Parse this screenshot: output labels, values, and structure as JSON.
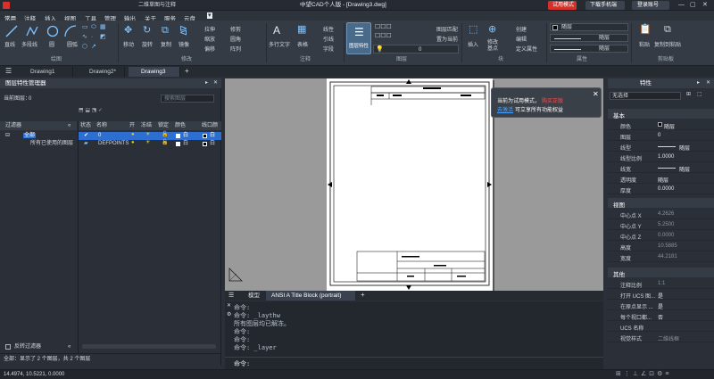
{
  "titlebar": {
    "app_title": "中望CAD个人版 - [Drawing3.dwg]",
    "workspace": "二维草图与注释",
    "trial_badge": "试用模式",
    "download_mobile": "下载手机端",
    "login": "登录账号"
  },
  "menu": {
    "items": [
      "常用",
      "注释",
      "插入",
      "视图",
      "工具",
      "管理",
      "输出",
      "关于",
      "服务",
      "云盘"
    ]
  },
  "ribbon": {
    "draw": [
      "直线",
      "多段线",
      "圆",
      "圆弧"
    ],
    "modify_big": [
      "移动",
      "旋转",
      "复制",
      "镜像"
    ],
    "modify_small": [
      "拉伸",
      "缩放",
      "偏移",
      "修剪",
      "圆角",
      "阵列"
    ],
    "annot": [
      "多行文字",
      "表格"
    ],
    "annot_small": [
      "线性",
      "引线",
      "字段"
    ],
    "layer_props": "图层特性",
    "layer_small": [
      "图层匹配",
      "置为当前"
    ],
    "layer_value": "0",
    "block": [
      "插入",
      "创建",
      "编辑",
      "定义属性"
    ],
    "block_base": "修改\n基点",
    "props": {
      "bylayer1": "随层",
      "bylayer2": "随层",
      "bylayer3": "随层"
    },
    "clip": [
      "粘贴",
      "复制到粘贴"
    ],
    "groups": [
      "绘图",
      "修改",
      "注释",
      "图层",
      "块",
      "属性",
      "剪贴板"
    ]
  },
  "tabs": {
    "items": [
      "Drawing1",
      "Drawing2*",
      "Drawing3"
    ]
  },
  "layer_manager": {
    "title": "图层特性管理器",
    "current_layer_label": "当前图层：",
    "current_layer": "0",
    "search_placeholder": "搜索图层",
    "filter_header": "过滤器",
    "filter_all": "全部",
    "filter_used": "所有已使用的图层",
    "columns": [
      "状态",
      "名称",
      "开",
      "冻结",
      "锁定",
      "颜色",
      "线口颜"
    ],
    "rows": [
      {
        "name": "0",
        "color": "白"
      },
      {
        "name": "DEFPOINTS",
        "color": "白"
      }
    ],
    "invert_filter": "反转过滤器",
    "footer": "全部：显示了 2 个图层，共 2 个图层"
  },
  "toast": {
    "line1": "当前为试用模式，",
    "line1_red": "购买正版",
    "line2_link": "去激活",
    "line2_rest": "可立享所有功能权益"
  },
  "canvas_tabs": {
    "model": "模型",
    "layout": "ANSI A Title Block (portrait)"
  },
  "command": {
    "lines": [
      "命令:",
      "命令: _laythw",
      "所有图层均已解冻。",
      "命令:",
      "命令:",
      "命令: _layer"
    ],
    "prompt": "命令:"
  },
  "properties": {
    "title": "特性",
    "selection": "无选择",
    "sections": {
      "basic": "基本",
      "view": "视图",
      "misc": "其他"
    },
    "basic": [
      [
        "颜色",
        "随层"
      ],
      [
        "图层",
        "0"
      ],
      [
        "线型",
        "随层"
      ],
      [
        "线型比例",
        "1.0000"
      ],
      [
        "线宽",
        "随层"
      ],
      [
        "透明度",
        "随层"
      ],
      [
        "厚度",
        "0.0000"
      ]
    ],
    "view": [
      [
        "中心点 X",
        "4.2626"
      ],
      [
        "中心点 Y",
        "5.2500"
      ],
      [
        "中心点 Z",
        "0.0000"
      ],
      [
        "高度",
        "10.5885"
      ],
      [
        "宽度",
        "44.2181"
      ]
    ],
    "misc": [
      [
        "注释比例",
        "1:1"
      ],
      [
        "打开 UCS 图...",
        "是"
      ],
      [
        "在原点显示 ...",
        "是"
      ],
      [
        "每个视口都...",
        "否"
      ],
      [
        "UCS 名称",
        ""
      ],
      [
        "视觉样式",
        "二维线框"
      ]
    ]
  },
  "status": {
    "coords": "14.4974, 10.5221, 0.0000"
  }
}
